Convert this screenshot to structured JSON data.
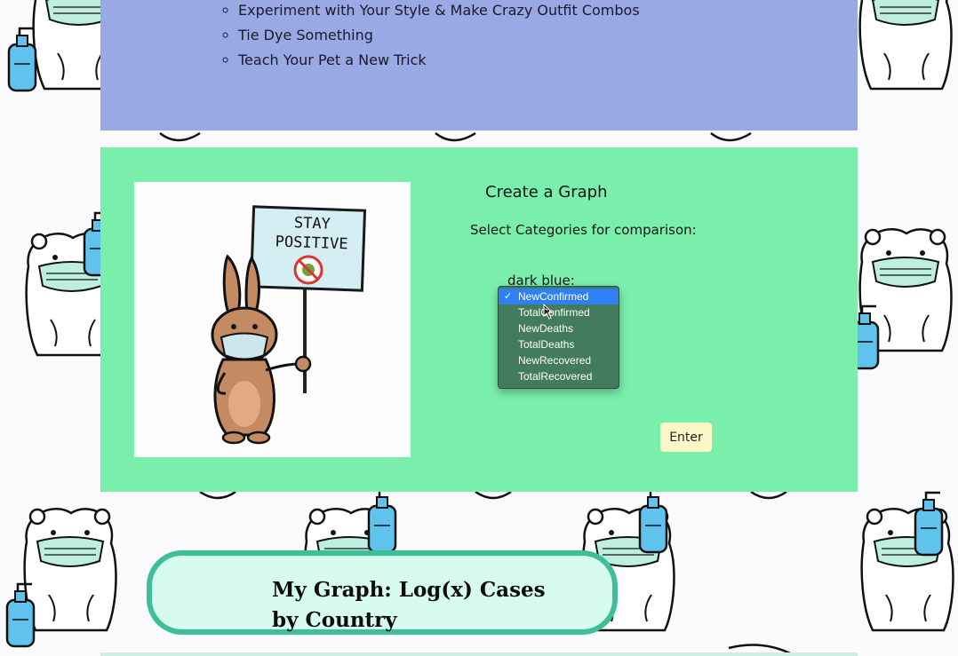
{
  "activities": {
    "items": [
      "Experiment with Your Style & Make Crazy Outfit Combos",
      "Tie Dye Something",
      "Teach Your Pet a New Trick"
    ]
  },
  "graph_panel": {
    "title": "Create a Graph",
    "instruction": "Select Categories for comparison:",
    "color_label": "dark blue:",
    "options": [
      "NewConfirmed",
      "TotalConfirmed",
      "NewDeaths",
      "TotalDeaths",
      "NewRecovered",
      "TotalRecovered"
    ],
    "selected_option": "NewConfirmed",
    "enter_label": "Enter",
    "poster": {
      "sign_line1": "STAY",
      "sign_line2": "POSITIVE"
    }
  },
  "banner": {
    "title_line1": "My Graph: Log(x) Cases",
    "title_line2": "by Country"
  },
  "colors": {
    "top_panel": "#98a9e3",
    "green_panel": "#7aefac",
    "dropdown_bg": "#437c5c",
    "selected_option": "#2f7ff5",
    "enter_button": "#fdf7c8",
    "banner_bg": "#d8fbf0",
    "banner_border": "#3fbf98"
  }
}
